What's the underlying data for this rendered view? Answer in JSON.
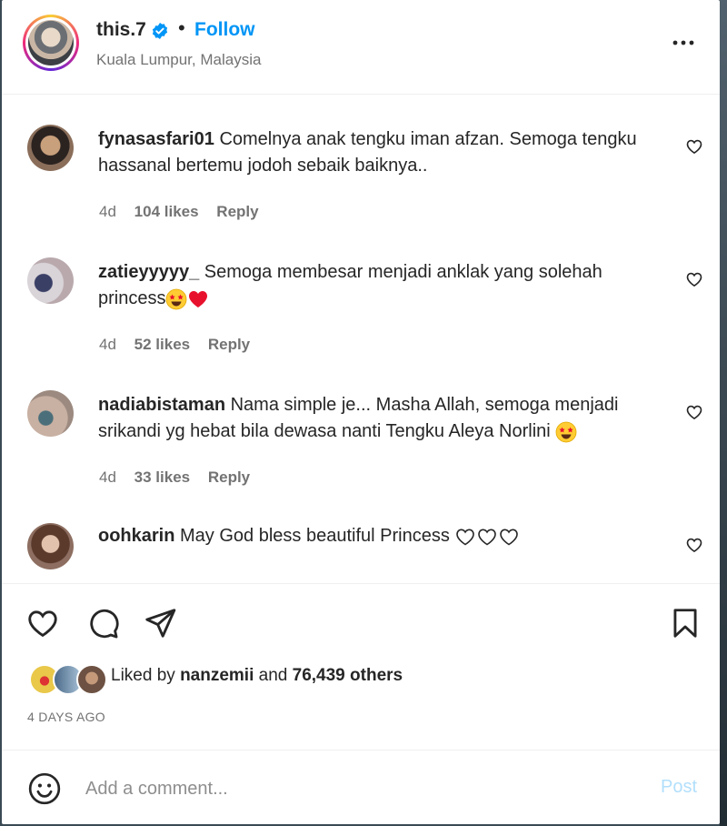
{
  "post": {
    "username": "this.7",
    "separator": "•",
    "follow_label": "Follow",
    "location": "Kuala Lumpur, Malaysia"
  },
  "comments": [
    {
      "username": "fynasasfari01",
      "text": "Comelnya anak tengku iman afzan. Semoga tengku hassanal bertemu jodoh sebaik baiknya..",
      "age": "4d",
      "likes": "104 likes",
      "reply": "Reply"
    },
    {
      "username": "zatieyyyyy_",
      "text": "Semoga membesar menjadi anklak yang solehah princess",
      "emojis": [
        "star-struck-emoji",
        "red-heart-emoji"
      ],
      "age": "4d",
      "likes": "52 likes",
      "reply": "Reply"
    },
    {
      "username": "nadiabistaman",
      "text": "Nama simple je... Masha Allah, semoga menjadi srikandi yg hebat bila dewasa nanti Tengku Aleya Norlini",
      "emojis": [
        "star-struck-emoji"
      ],
      "age": "4d",
      "likes": "33 likes",
      "reply": "Reply"
    },
    {
      "username": "oohkarin",
      "text": "May God bless beautiful Princess",
      "emojis": [
        "white-heart-emoji",
        "white-heart-emoji",
        "white-heart-emoji"
      ]
    }
  ],
  "liked_by": {
    "prefix": "Liked by",
    "user": "nanzemii",
    "conjunction": "and",
    "others": "76,439 others"
  },
  "timestamp": "4 DAYS AGO",
  "comment_box": {
    "placeholder": "Add a comment...",
    "post_label": "Post"
  },
  "colors": {
    "link_blue": "#0095f6",
    "post_disabled": "#b2dffc",
    "muted": "#737373",
    "heart_red": "#e8112d"
  }
}
